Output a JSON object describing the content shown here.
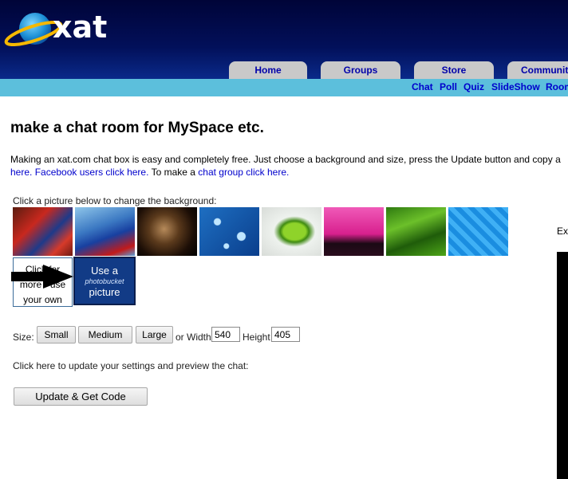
{
  "brand": {
    "logo_text": "xat"
  },
  "nav": {
    "tabs": [
      "Home",
      "Groups",
      "Store",
      "Communit"
    ],
    "sub_links": [
      "Chat",
      "Poll",
      "Quiz",
      "SlideShow",
      "Room"
    ]
  },
  "page": {
    "title": "make a chat room for MySpace etc.",
    "intro_line1": "Making an xat.com chat box is easy and completely free. Just choose a background and size, press the Update button and copy a",
    "intro_link1": "here.",
    "intro_link2": "Facebook users click here.",
    "intro_text2": "To make a",
    "intro_link3": "chat group click here."
  },
  "backgrounds": {
    "prompt": "Click a picture below to change the background:",
    "thumbnails": [
      "spider-man",
      "superman",
      "movie-hero",
      "water-drops",
      "green-lime",
      "concert-crowd",
      "green-grass",
      "blue-water"
    ],
    "own_button": [
      "Click for",
      "more - use",
      "your own"
    ],
    "photobucket": {
      "line1": "Use a",
      "brand": "photobucket",
      "line3": "picture"
    }
  },
  "size": {
    "label": "Size:",
    "small": "Small",
    "medium": "Medium",
    "large": "Large",
    "or_width": "or Width",
    "width_value": "540",
    "height_label": "Height",
    "height_value": "405"
  },
  "update": {
    "prompt": "Click here to update your settings and preview the chat:",
    "button": "Update & Get Code"
  },
  "side": {
    "label": "Ex"
  }
}
